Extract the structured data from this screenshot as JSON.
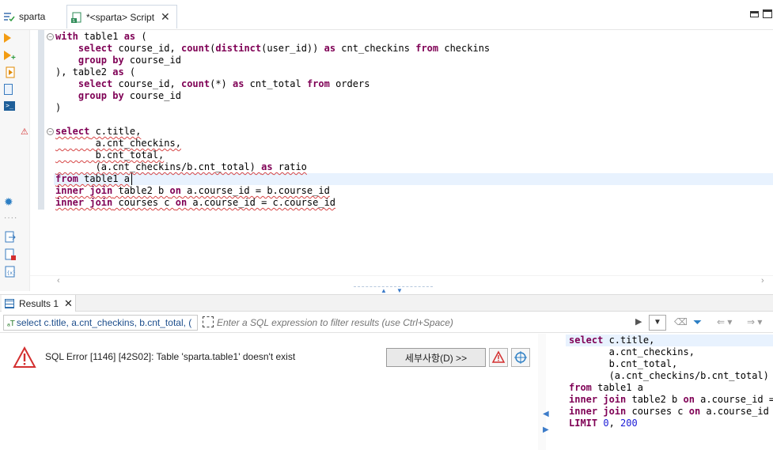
{
  "tabs": {
    "project_tab": "sparta",
    "script_tab": "*<sparta> Script"
  },
  "editor": {
    "lines": [
      "with table1 as (",
      "    select course_id, count(distinct(user_id)) as cnt_checkins from checkins",
      "    group by course_id",
      "), table2 as (",
      "    select course_id, count(*) as cnt_total from orders",
      "    group by course_id",
      ")",
      "",
      "select c.title,",
      "       a.cnt_checkins,",
      "       b.cnt_total,",
      "       (a.cnt_checkins/b.cnt_total) as ratio",
      "from table1 a",
      "inner join table2 b on a.course_id = b.course_id",
      "inner join courses c on a.course_id = c.course_id"
    ]
  },
  "results": {
    "tab_label": "Results 1",
    "sql_chip": "select c.title, a.cnt_checkins, b.cnt_total, (",
    "filter_placeholder": "Enter a SQL expression to filter results (use Ctrl+Space)",
    "error_message": "SQL Error [1146] [42S02]: Table 'sparta.table1' doesn't exist",
    "details_button": "세부사항(D) >>",
    "preview_lines": [
      "select c.title,",
      "       a.cnt_checkins,",
      "       b.cnt_total,",
      "       (a.cnt_checkins/b.cnt_total)",
      "from table1 a",
      "inner join table2 b on a.course_id =",
      "inner join courses c on a.course_id",
      "LIMIT 0, 200"
    ]
  },
  "colors": {
    "keyword": "#7f0055",
    "number": "#1a1ad6",
    "error": "#d32f2f",
    "accent": "#2d7fc4",
    "current_line": "#e8f2fe"
  }
}
